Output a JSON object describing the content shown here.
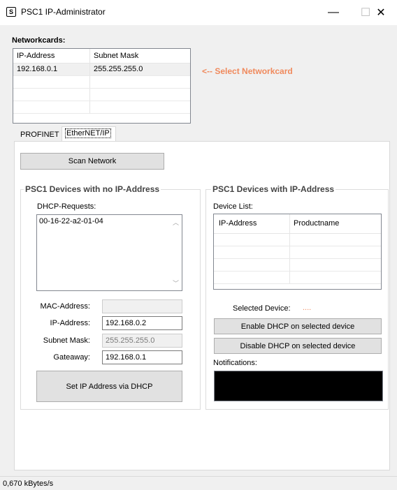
{
  "window": {
    "title": "PSC1 IP-Administrator",
    "icon_glyph": "S",
    "minimize": "—",
    "maximize": "☐",
    "close": "✕"
  },
  "networkcards": {
    "label": "Networkcards:",
    "columns": [
      "IP-Address",
      "Subnet Mask"
    ],
    "rows": [
      {
        "ip": "192.168.0.1",
        "mask": "255.255.255.0"
      }
    ],
    "hint": "<-- Select Networkcard",
    "hint_color": "#f08a5d"
  },
  "tabs": {
    "profinet": "PROFINET",
    "ethernet_ip": "EtherNET/IP",
    "active": "EtherNET/IP"
  },
  "scan_button": "Scan Network",
  "no_ip_group": {
    "title": "PSC1 Devices with no IP-Address",
    "dhcp_label": "DHCP-Requests:",
    "dhcp_items": [
      "00-16-22-a2-01-04"
    ],
    "mac_label": "MAC-Address:",
    "mac_value": "",
    "ip_label": "IP-Address:",
    "ip_value": "192.168.0.2",
    "mask_label": "Subnet Mask:",
    "mask_value": "255.255.255.0",
    "gateway_label": "Gateaway:",
    "gateway_value": "192.168.0.1",
    "set_button": "Set IP Address via DHCP"
  },
  "ip_group": {
    "title": "PSC1 Devices with IP-Address",
    "device_list_label": "Device List:",
    "columns": [
      "IP-Address",
      "Productname"
    ],
    "selected_label": "Selected Device:",
    "selected_value": "....",
    "selected_color": "#f08a5d",
    "enable_button": "Enable DHCP on selected device",
    "disable_button": "Disable DHCP on selected device",
    "notifications_label": "Notifications:"
  },
  "status": {
    "throughput": "0,670 kBytes/s"
  }
}
